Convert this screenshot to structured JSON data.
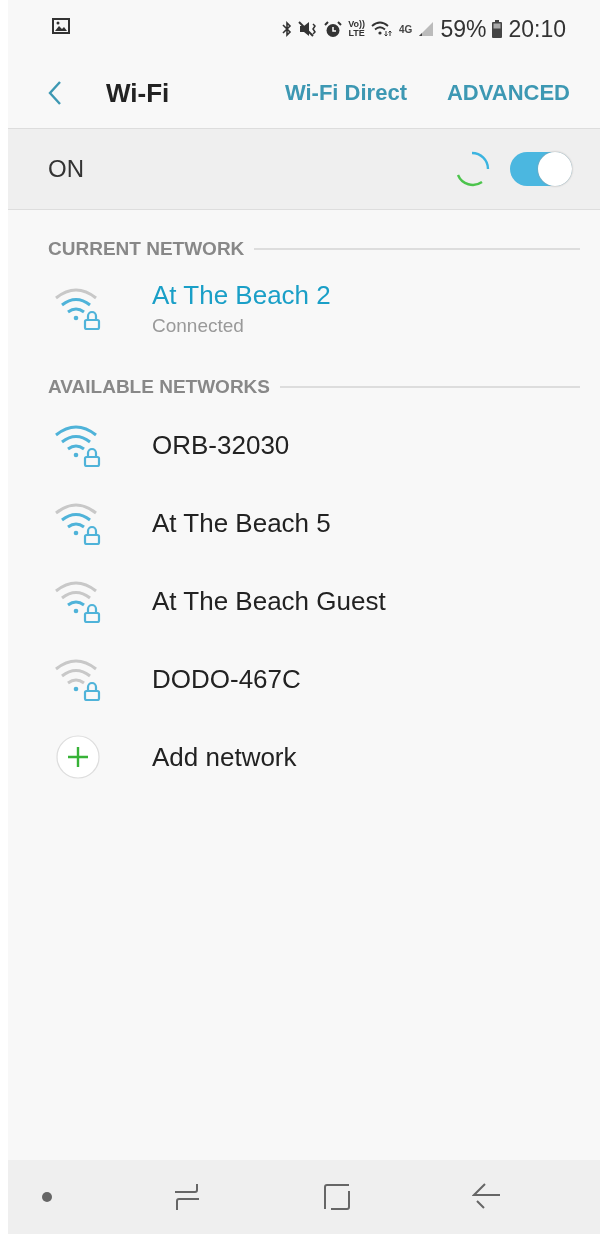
{
  "status_bar": {
    "volte_top": "Vo))",
    "volte_bottom": "LTE",
    "network_type": "4G",
    "battery": "59%",
    "time": "20:10"
  },
  "header": {
    "title": "Wi-Fi",
    "actions": [
      "Wi-Fi Direct",
      "ADVANCED"
    ]
  },
  "master_switch": {
    "label": "ON",
    "on": true,
    "scanning": true
  },
  "current_network": {
    "heading": "CURRENT NETWORK",
    "name": "At The Beach 2",
    "status": "Connected",
    "kind": "good",
    "secured": true
  },
  "available_networks": {
    "heading": "AVAILABLE NETWORKS",
    "items": [
      {
        "name": "ORB-32030",
        "kind": "full",
        "secured": true
      },
      {
        "name": "At The Beach 5",
        "kind": "good",
        "secured": true
      },
      {
        "name": "At The Beach Guest",
        "kind": "fair",
        "secured": true
      },
      {
        "name": "DODO-467C",
        "kind": "weak",
        "secured": true
      }
    ]
  },
  "add_network": {
    "label": "Add network"
  }
}
